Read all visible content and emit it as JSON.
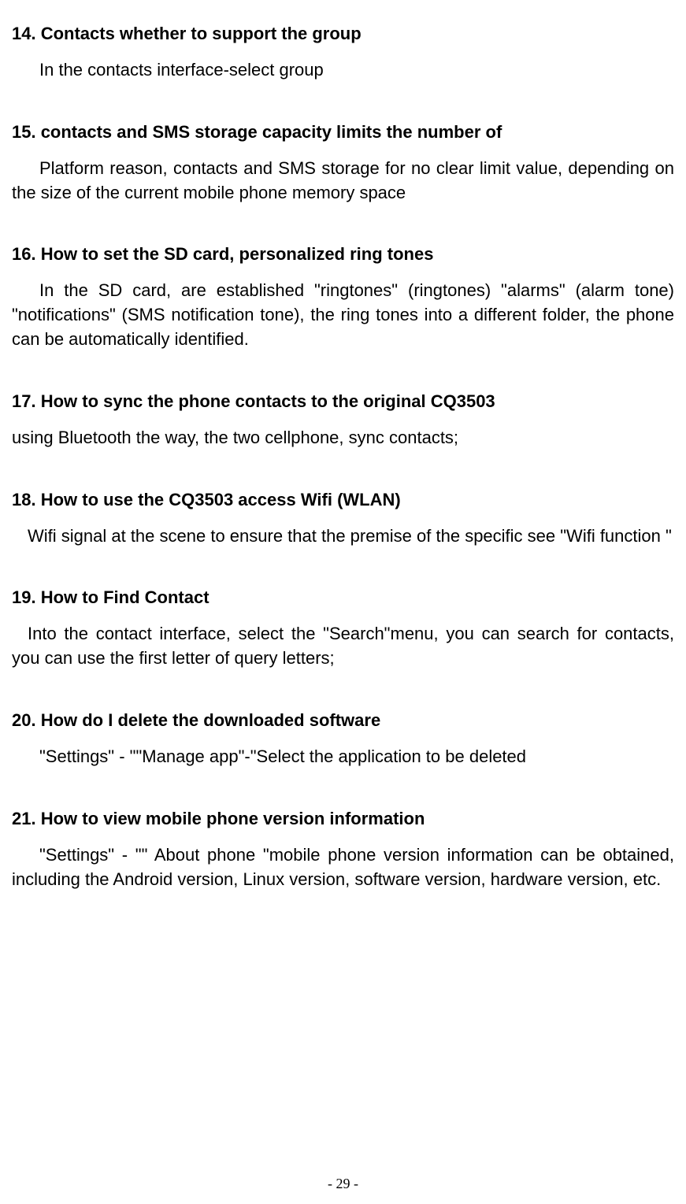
{
  "sections": [
    {
      "heading": "14. Contacts whether to support the group",
      "body": "In the contacts interface-select group",
      "indent": "indent"
    },
    {
      "heading": "15. contacts and SMS storage capacity limits the number of",
      "body": "Platform reason, contacts and SMS storage for no clear limit value, depending on the size of the current mobile phone memory space",
      "indent": "indent"
    },
    {
      "heading": "16. How to set the SD card, personalized ring tones",
      "body": "In the SD card, are established \"ringtones\" (ringtones) \"alarms\" (alarm tone) \"notifications\" (SMS notification tone), the ring tones into a different folder, the phone can be automatically identified.",
      "indent": "indent"
    },
    {
      "heading": "17. How to sync the phone contacts to the original CQ3503",
      "body": "using Bluetooth the way, the two cellphone, sync contacts;",
      "indent": "none"
    },
    {
      "heading": "18. How to use the CQ3503 access Wifi (WLAN)",
      "body": "Wifi signal at the scene to ensure that the premise of the specific see \"Wifi function \"",
      "indent": "small"
    },
    {
      "heading": "19. How to Find Contact",
      "body": "Into the contact interface, select the \"Search\"menu, you can search for contacts, you can use the first letter of query letters;",
      "indent": "small"
    },
    {
      "heading": "20. How do I delete the downloaded software",
      "body": "\"Settings\" - \"\"Manage app\"-\"Select the application to be deleted",
      "indent": "indent"
    },
    {
      "heading": "21. How to view mobile phone version information",
      "body": "\"Settings\" - \"\" About phone \"mobile phone version information can be obtained, including the Android version, Linux version, software version, hardware version, etc.",
      "indent": "indent"
    }
  ],
  "pageNumber": "- 29 -"
}
